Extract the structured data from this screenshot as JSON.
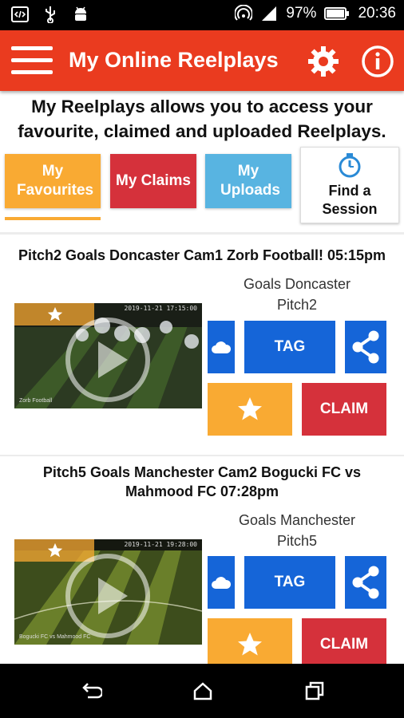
{
  "status_bar": {
    "battery": "97%",
    "time": "20:36",
    "left_icons": [
      "code-icon",
      "usb-icon",
      "android-icon"
    ],
    "right_icons": [
      "hotspot-icon",
      "signal-icon",
      "battery-icon"
    ]
  },
  "app_bar": {
    "title": "My Online Reelplays",
    "icons": [
      "menu-icon",
      "gear-icon",
      "info-icon"
    ]
  },
  "intro": "My Reelplays allows you to access your favourite, claimed and uploaded Reelplays.",
  "tabs": [
    {
      "label": "My Favourites",
      "color": "#f9aa33",
      "active": true
    },
    {
      "label": "My Claims",
      "color": "#d5313b"
    },
    {
      "label": "My Uploads",
      "color": "#58b4e1"
    },
    {
      "label": "Find a Session",
      "icon": "stopwatch-icon"
    }
  ],
  "reelplays": [
    {
      "title": "Pitch2 Goals Doncaster Cam1 Zorb Football! 05:15pm",
      "venue": "Goals Doncaster",
      "pitch": "Pitch2",
      "tag_label": "TAG",
      "claim_label": "CLAIM",
      "thumbnail_caption": "Zorb Football",
      "thumbnail_timestamp": "2019-11-21 17:15:00"
    },
    {
      "title": "Pitch5 Goals Manchester Cam2 Bogucki FC vs Mahmood FC 07:28pm",
      "venue": "Goals Manchester",
      "pitch": "Pitch5",
      "tag_label": "TAG",
      "claim_label": "CLAIM",
      "thumbnail_caption": "Bogucki FC vs Mahmood FC",
      "thumbnail_timestamp": "2019-11-21 19:28:00"
    }
  ],
  "colors": {
    "app_bar": "#ea3b1f",
    "action_blue": "#1565d8",
    "favourite_orange": "#f9aa33",
    "claim_red": "#d5313b",
    "uploads_blue": "#58b4e1"
  },
  "nav_bar": [
    "back-icon",
    "home-icon",
    "recents-icon"
  ]
}
